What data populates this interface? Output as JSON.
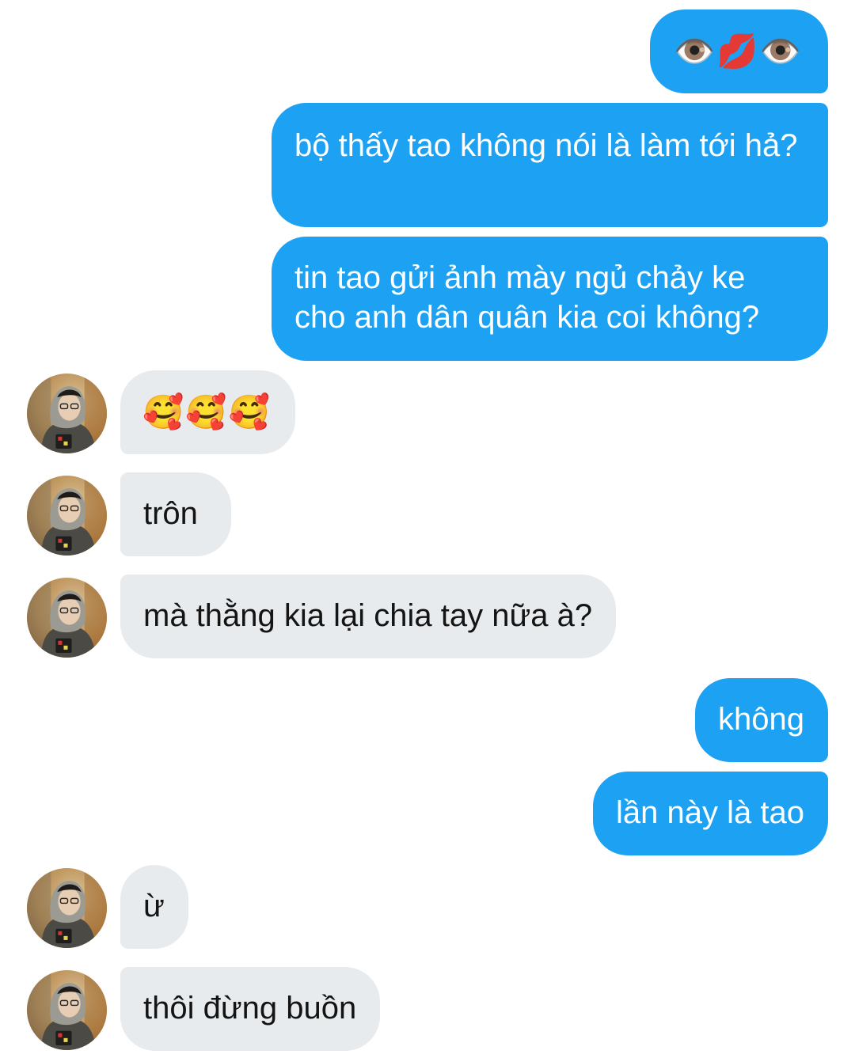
{
  "conversation": {
    "messages": [
      {
        "id": "m1",
        "side": "sent",
        "text": "👁️💋👁️"
      },
      {
        "id": "m2",
        "side": "sent",
        "text": "bộ thấy tao không nói là làm tới hả?"
      },
      {
        "id": "m3",
        "side": "sent",
        "text": "tin tao gửi ảnh mày ngủ chảy ke cho anh dân quân kia coi không?"
      },
      {
        "id": "m4",
        "side": "received",
        "text": "🥰🥰🥰"
      },
      {
        "id": "m5",
        "side": "received",
        "text": "trôn"
      },
      {
        "id": "m6",
        "side": "received",
        "text": "mà thằng kia lại chia tay nữa à?"
      },
      {
        "id": "m7",
        "side": "sent",
        "text": "không"
      },
      {
        "id": "m8",
        "side": "sent",
        "text": "lần này là tao"
      },
      {
        "id": "m9",
        "side": "received",
        "text": "ừ"
      },
      {
        "id": "m10",
        "side": "received",
        "text": "thôi đừng buồn"
      }
    ]
  },
  "colors": {
    "sent_bubble": "#1da1f2",
    "received_bubble": "#e8ebed",
    "sent_text": "#ffffff",
    "received_text": "#141414"
  },
  "icons": {
    "avatar": "contact-avatar-photo"
  }
}
